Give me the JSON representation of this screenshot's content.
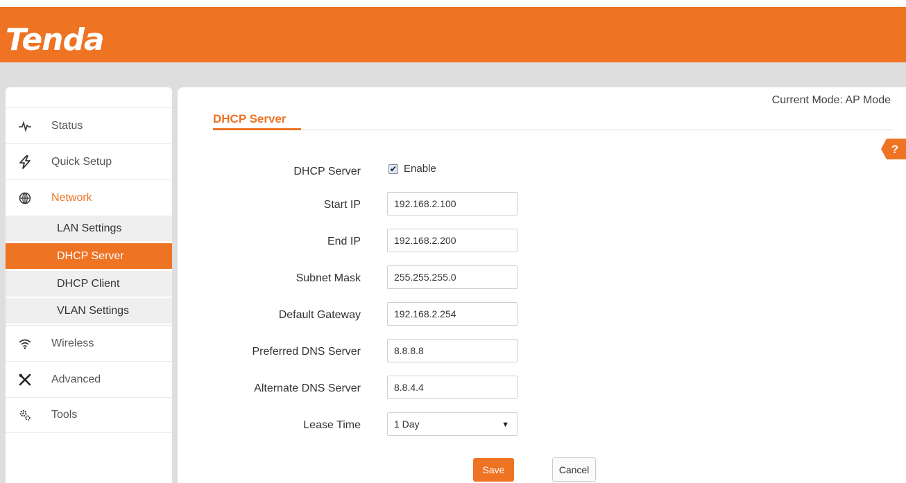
{
  "brand": {
    "logo": "Tenda",
    "color": "#ee7323"
  },
  "header": {
    "mode": "Current Mode: AP Mode"
  },
  "sidebar": {
    "items": [
      {
        "label": "Status",
        "icon": "pulse-icon"
      },
      {
        "label": "Quick Setup",
        "icon": "lightning-icon"
      },
      {
        "label": "Network",
        "icon": "globe-icon",
        "active": true
      },
      {
        "label": "Wireless",
        "icon": "wifi-icon"
      },
      {
        "label": "Advanced",
        "icon": "tools-cross-icon"
      },
      {
        "label": "Tools",
        "icon": "gears-icon"
      }
    ],
    "network_subitems": [
      {
        "label": "LAN Settings"
      },
      {
        "label": "DHCP Server",
        "selected": true
      },
      {
        "label": "DHCP Client"
      },
      {
        "label": "VLAN Settings"
      }
    ]
  },
  "main": {
    "title": "DHCP Server",
    "help": "?",
    "form": {
      "dhcp_server": {
        "label": "DHCP Server",
        "checkbox_label": "Enable",
        "checked": true
      },
      "start_ip": {
        "label": "Start IP",
        "value": "192.168.2.100"
      },
      "end_ip": {
        "label": "End IP",
        "value": "192.168.2.200"
      },
      "subnet_mask": {
        "label": "Subnet Mask",
        "value": "255.255.255.0"
      },
      "default_gateway": {
        "label": "Default Gateway",
        "value": "192.168.2.254"
      },
      "preferred_dns": {
        "label": "Preferred DNS Server",
        "value": "8.8.8.8"
      },
      "alternate_dns": {
        "label": "Alternate DNS Server",
        "value": "8.8.4.4"
      },
      "lease_time": {
        "label": "Lease Time",
        "value": "1 Day"
      }
    },
    "buttons": {
      "save": "Save",
      "cancel": "Cancel"
    }
  }
}
